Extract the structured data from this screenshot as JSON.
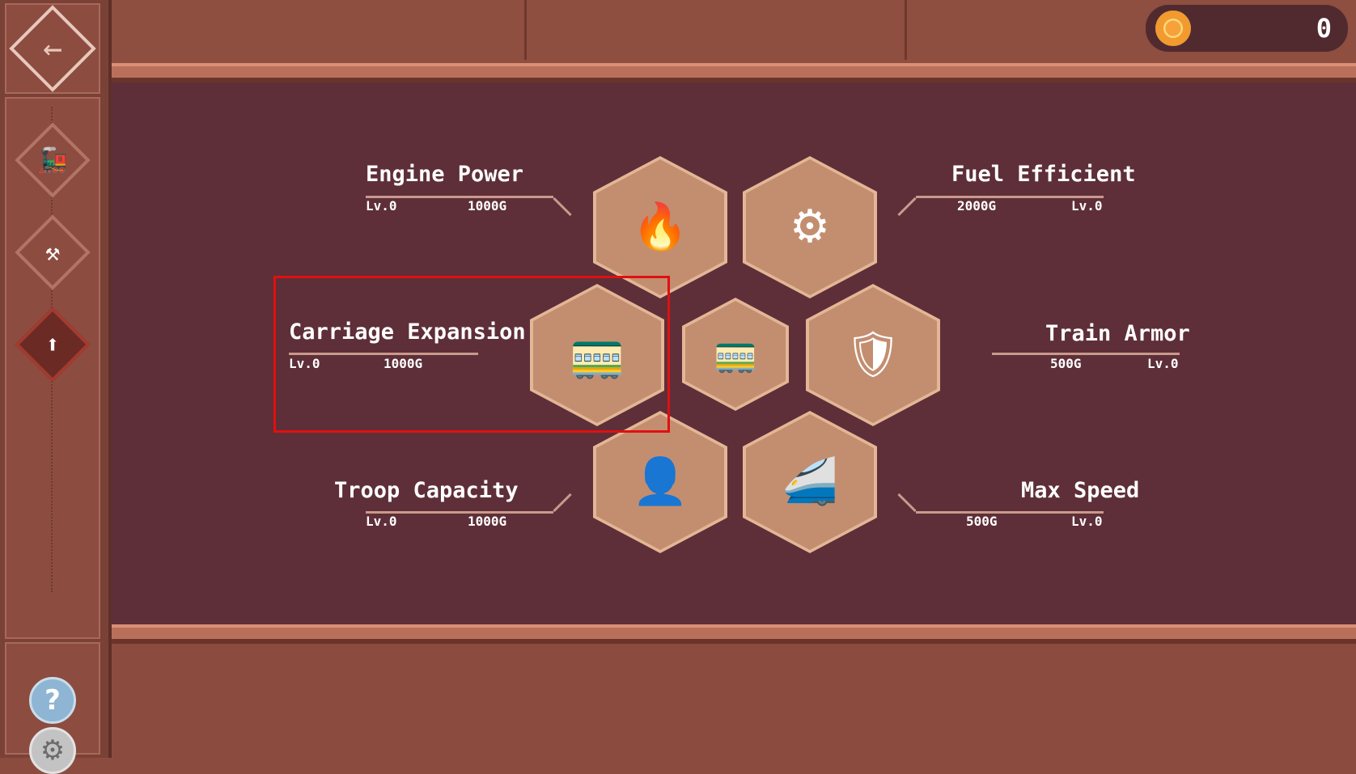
{
  "currency": {
    "icon": "gold-coin-icon",
    "value": "0"
  },
  "sidebar": {
    "back": {
      "icon": "back-arrow-icon"
    },
    "items": [
      {
        "name": "train",
        "icon": "train-icon",
        "glyph": "🚂",
        "active": false
      },
      {
        "name": "build",
        "icon": "hammer-icon",
        "glyph": "⚒",
        "active": false
      },
      {
        "name": "upgrade",
        "icon": "upgrade-arrow-icon",
        "glyph": "⬆",
        "active": true
      }
    ],
    "help": {
      "icon": "help-icon",
      "glyph": "?"
    },
    "settings": {
      "icon": "settings-gear-icon",
      "glyph": "⚙"
    }
  },
  "upgrades": {
    "engine_power": {
      "title": "Engine Power",
      "level": "Lv.0",
      "cost": "1000G",
      "icon": "speedometer-flame-icon"
    },
    "fuel_efficient": {
      "title": "Fuel Efficient",
      "level": "Lv.0",
      "cost": "2000G",
      "icon": "engine-block-icon"
    },
    "carriage_expansion": {
      "title": "Carriage Expansion",
      "level": "Lv.0",
      "cost": "1000G",
      "icon": "train-plus-icon"
    },
    "train_armor": {
      "title": "Train Armor",
      "level": "Lv.0",
      "cost": "500G",
      "icon": "armor-shield-icon"
    },
    "troop_capacity": {
      "title": "Troop Capacity",
      "level": "Lv.0",
      "cost": "1000G",
      "icon": "soldier-plus-icon"
    },
    "max_speed": {
      "title": "Max Speed",
      "level": "Lv.0",
      "cost": "500G",
      "icon": "speeding-train-icon"
    },
    "center": {
      "icon": "train-icon"
    }
  },
  "colors": {
    "highlight": "#e01010",
    "panel": "#5e2f38",
    "hex": "#c38e70"
  }
}
